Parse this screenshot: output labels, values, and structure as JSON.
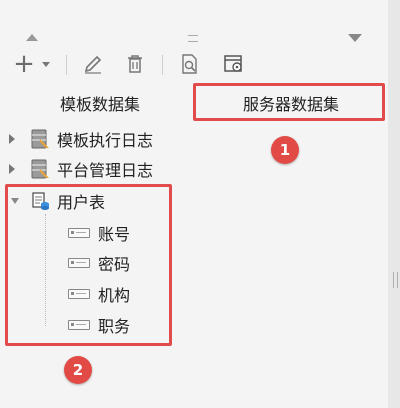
{
  "toolbar": {
    "add_label": "+",
    "icons": [
      "plus-icon",
      "chevron-down-icon",
      "pencil-icon",
      "trash-icon",
      "preview-icon",
      "dataset-settings-icon"
    ]
  },
  "tabs": {
    "template": "模板数据集",
    "server": "服务器数据集"
  },
  "tree": {
    "items": [
      {
        "label": "模板执行日志",
        "expanded": false
      },
      {
        "label": "平台管理日志",
        "expanded": false
      },
      {
        "label": "用户表",
        "expanded": true,
        "children": [
          "账号",
          "密码",
          "机构",
          "职务"
        ]
      }
    ]
  },
  "annotations": {
    "badge1": "1",
    "badge2": "2"
  },
  "colors": {
    "highlight": "#e14b4b",
    "badge": "#e24b45"
  }
}
